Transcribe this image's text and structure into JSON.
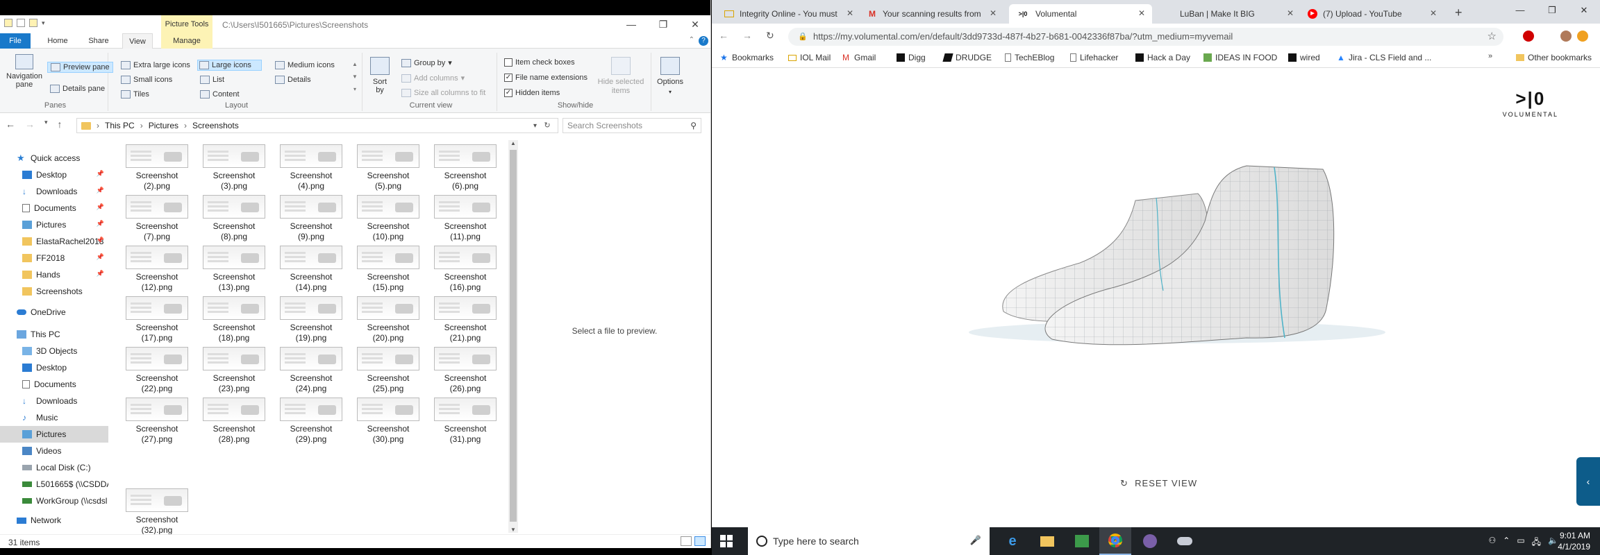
{
  "explorer": {
    "window_path": "C:\\Users\\I501665\\Pictures\\Screenshots",
    "context_tab": "Picture Tools",
    "tabs": {
      "file": "File",
      "home": "Home",
      "share": "Share",
      "view": "View",
      "manage": "Manage"
    },
    "ribbon": {
      "panes": {
        "nav_pane": "Navigation pane",
        "preview_pane": "Preview pane",
        "details_pane": "Details pane",
        "label": "Panes"
      },
      "layout": {
        "extra_large": "Extra large icons",
        "large": "Large icons",
        "medium": "Medium icons",
        "small": "Small icons",
        "list": "List",
        "details": "Details",
        "tiles": "Tiles",
        "content": "Content",
        "label": "Layout"
      },
      "current_view": {
        "sort_by": "Sort by",
        "group_by": "Group by",
        "add_columns": "Add columns",
        "size_all": "Size all columns to fit",
        "label": "Current view"
      },
      "show_hide": {
        "item_checkboxes": "Item check boxes",
        "file_ext": "File name extensions",
        "hidden_items": "Hidden items",
        "hide_selected": "Hide selected items",
        "label": "Show/hide"
      },
      "options": "Options"
    },
    "breadcrumb": [
      "This PC",
      "Pictures",
      "Screenshots"
    ],
    "search_placeholder": "Search Screenshots",
    "nav": {
      "quick_access": "Quick access",
      "desktop": "Desktop",
      "downloads": "Downloads",
      "documents": "Documents",
      "pictures": "Pictures",
      "elasta": "ElastaRachel2018",
      "ff2018": "FF2018",
      "hands": "Hands",
      "screenshots": "Screenshots",
      "onedrive": "OneDrive",
      "this_pc": "This PC",
      "objects3d": "3D Objects",
      "desktop2": "Desktop",
      "documents2": "Documents",
      "downloads2": "Downloads",
      "music": "Music",
      "pictures2": "Pictures",
      "videos": "Videos",
      "local_disk": "Local Disk (C:)",
      "l501665": "L501665$ (\\\\CSDDA",
      "workgroup": "WorkGroup (\\\\csdsl",
      "network": "Network"
    },
    "files": [
      "Screenshot (2).png",
      "Screenshot (3).png",
      "Screenshot (4).png",
      "Screenshot (5).png",
      "Screenshot (6).png",
      "Screenshot (7).png",
      "Screenshot (8).png",
      "Screenshot (9).png",
      "Screenshot (10).png",
      "Screenshot (11).png",
      "Screenshot (12).png",
      "Screenshot (13).png",
      "Screenshot (14).png",
      "Screenshot (15).png",
      "Screenshot (16).png",
      "Screenshot (17).png",
      "Screenshot (18).png",
      "Screenshot (19).png",
      "Screenshot (20).png",
      "Screenshot (21).png",
      "Screenshot (22).png",
      "Screenshot (23).png",
      "Screenshot (24).png",
      "Screenshot (25).png",
      "Screenshot (26).png",
      "Screenshot (27).png",
      "Screenshot (28).png",
      "Screenshot (29).png",
      "Screenshot (30).png",
      "Screenshot (31).png",
      "Screenshot (32).png"
    ],
    "preview_text": "Select a file to preview.",
    "item_count": "31 items"
  },
  "chrome": {
    "tabs": [
      {
        "title": "Integrity Online - You must",
        "icon": "mail-icon"
      },
      {
        "title": "Your scanning results from",
        "icon": "gmail-icon"
      },
      {
        "title": "Volumental",
        "icon": "volumental-icon"
      },
      {
        "title": "LuBan | Make It BIG",
        "icon": "blank-icon"
      },
      {
        "title": "(7) Upload - YouTube",
        "icon": "youtube-icon"
      }
    ],
    "url": "https://my.volumental.com/en/default/3dd9733d-487f-4b27-b681-0042336f87ba/?utm_medium=myvemail",
    "bookmarks": [
      "Bookmarks",
      "IOL Mail",
      "Gmail",
      "Digg",
      "DRUDGE",
      "TechEBlog",
      "Lifehacker",
      "Hack a Day",
      "IDEAS IN FOOD",
      "wired",
      "Jira - CLS Field and ..."
    ],
    "other_bookmarks": "Other bookmarks",
    "logo_mark": ">|0",
    "logo_word": "VOLUMENTAL",
    "reset_view": "RESET VIEW"
  },
  "taskbar": {
    "search_placeholder": "Type here to search",
    "time": "9:01 AM",
    "date": "4/1/2019"
  }
}
